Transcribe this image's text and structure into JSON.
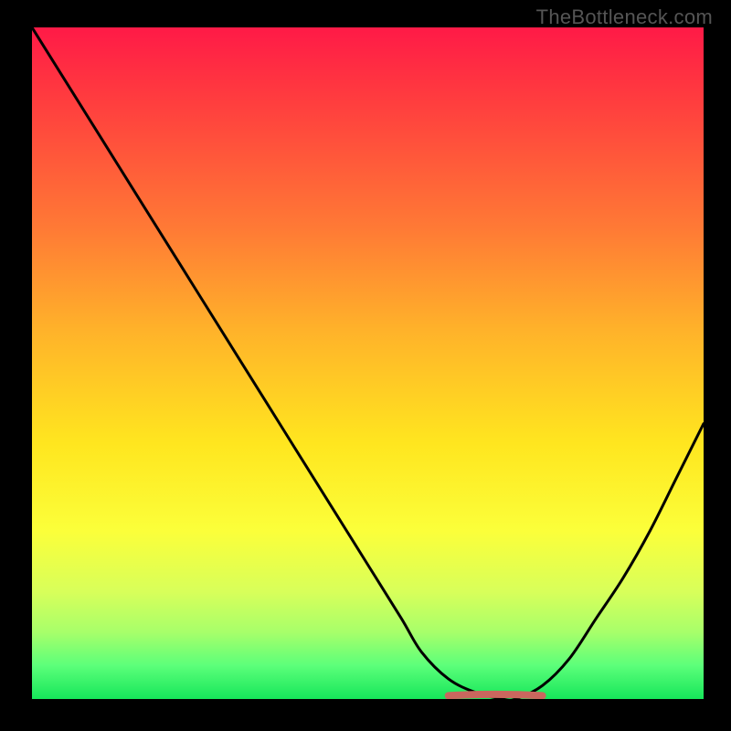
{
  "watermark": {
    "text": "TheBottleneck.com"
  },
  "colors": {
    "curve": "#000000",
    "accent": "#c9675e",
    "background": "#000000"
  },
  "chart_data": {
    "type": "line",
    "title": "",
    "xlabel": "",
    "ylabel": "",
    "xlim": [
      0,
      100
    ],
    "ylim": [
      0,
      100
    ],
    "grid": false,
    "series": [
      {
        "name": "bottleneck-curve",
        "x": [
          0,
          5,
          10,
          15,
          20,
          25,
          30,
          35,
          40,
          45,
          50,
          55,
          58,
          62,
          66,
          70,
          72,
          76,
          80,
          84,
          88,
          92,
          96,
          100
        ],
        "y": [
          100,
          92,
          84,
          76,
          68,
          60,
          52,
          44,
          36,
          28,
          20,
          12,
          7,
          3,
          1,
          0,
          0,
          2,
          6,
          12,
          18,
          25,
          33,
          41
        ]
      }
    ],
    "annotations": [
      {
        "name": "optimal-range",
        "shape": "segment",
        "x0": 62,
        "x1": 76,
        "y": 0.5,
        "color": "#c9675e"
      }
    ]
  }
}
